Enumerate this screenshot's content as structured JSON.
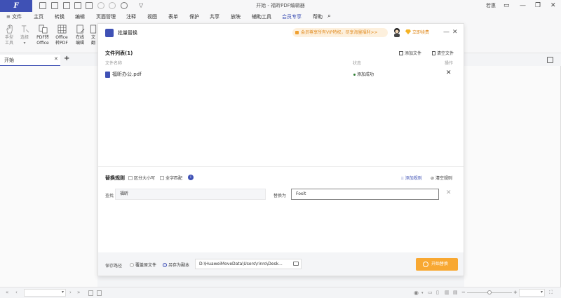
{
  "app": {
    "title": "开始 - 福昕PDF编辑器",
    "user": "若惠",
    "window_controls": [
      "—",
      "□",
      "❐",
      "✕"
    ],
    "brand_color": "#3f51b5",
    "accent_color": "#f8a832"
  },
  "menu": {
    "items": [
      "≡ 文件",
      "主页",
      "转换",
      "编辑",
      "页面管理",
      "注释",
      "视图",
      "表单",
      "保护",
      "共享",
      "放映",
      "辅助工具",
      "会员专享",
      "帮助"
    ],
    "active_index": 12
  },
  "ribbon": {
    "buttons": [
      {
        "label1": "手型",
        "label2": "工具",
        "icon": "hand-icon"
      },
      {
        "label1": "选择",
        "label2": "▾",
        "icon": "select-icon"
      },
      {
        "label1": "PDF转",
        "label2": "Office",
        "icon": "pdf-to-office-icon"
      },
      {
        "label1": "Office",
        "label2": "转PDF",
        "icon": "office-to-pdf-icon"
      },
      {
        "label1": "在线",
        "label2": "编辑",
        "icon": "online-edit-icon"
      },
      {
        "label1": "文",
        "label2": "翻",
        "icon": "doc-icon"
      }
    ]
  },
  "tabs": {
    "current": "开始",
    "close": "✕",
    "add": "+"
  },
  "dialog": {
    "title": "批量替换",
    "promo": "会员尊享所有VIP特权，尽享海量福利>>",
    "vip_button": "立即续费",
    "file_list": {
      "title": "文件列表(1)",
      "add_files": "添加文件",
      "clear_files": "清空文件",
      "headers": {
        "name": "文件名称",
        "status": "状态",
        "action": "操作"
      },
      "rows": [
        {
          "name": "福昕办公.pdf",
          "status": "添加成功"
        }
      ]
    },
    "rules": {
      "title": "替换规则",
      "case_sensitive": "区分大小写",
      "whole_word": "全字匹配",
      "add_rule": "添加规则",
      "clear_rules": "清空规则",
      "find_label": "查找",
      "find_value": "福昕",
      "replace_label": "替换为",
      "replace_value": "Foxit"
    },
    "footer": {
      "save_label": "保存路径",
      "overwrite": "覆盖原文件",
      "save_as": "另存为副本",
      "path": "D:\\HuaweiMoveData\\Users\\rinro\\Desk...",
      "start": "开始替换"
    }
  },
  "statusbar": {
    "zoom_minus": "−",
    "zoom_plus": "+"
  }
}
